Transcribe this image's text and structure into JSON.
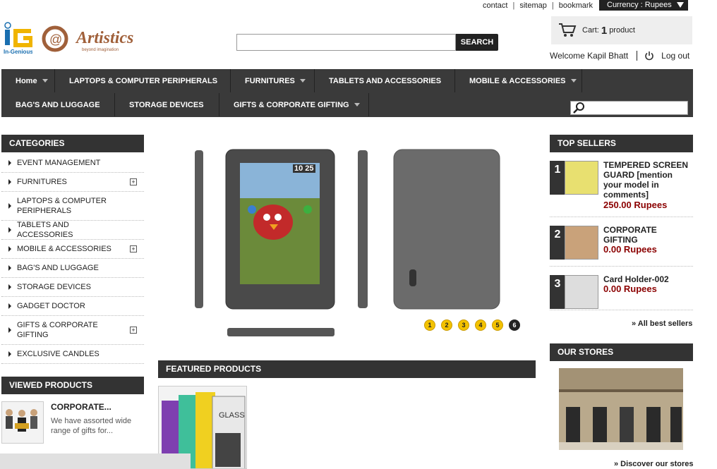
{
  "top_links": [
    "contact",
    "sitemap",
    "bookmark"
  ],
  "currency_label": "Currency : Rupees",
  "logo": {
    "brand1": "In-Genious",
    "brand2": "Artistics",
    "tagline": "beyond imagination"
  },
  "search": {
    "button": "SEARCH",
    "placeholder": ""
  },
  "cart": {
    "label": "Cart:",
    "count": "1",
    "unit": "product"
  },
  "user": {
    "welcome": "Welcome Kapil Bhatt",
    "logout": "Log out"
  },
  "nav": {
    "row1": [
      "Home",
      "LAPTOPS & COMPUTER PERIPHERALS",
      "FURNITURES",
      "TABLETS AND ACCESSORIES",
      "MOBILE & ACCESSORIES"
    ],
    "row2": [
      "BAG'S AND LUGGAGE",
      "STORAGE DEVICES",
      "GIFTS & CORPORATE GIFTING"
    ]
  },
  "categories": {
    "title": "CATEGORIES",
    "items": [
      "EVENT MANAGEMENT",
      "FURNITURES",
      "LAPTOPS & COMPUTER PERIPHERALS",
      "TABLETS AND ACCESSORIES",
      "MOBILE & ACCESSORIES",
      "BAG'S AND LUGGAGE",
      "STORAGE DEVICES",
      "GADGET DOCTOR",
      "GIFTS & CORPORATE GIFTING",
      "EXCLUSIVE CANDLES"
    ]
  },
  "viewed": {
    "title": "VIEWED PRODUCTS",
    "name": "CORPORATE...",
    "desc": "We have assorted wide range of gifts for..."
  },
  "slider": {
    "pages": [
      "1",
      "2",
      "3",
      "4",
      "5",
      "6"
    ],
    "active": "6",
    "clock": "10 25"
  },
  "featured": {
    "title": "FEATURED PRODUCTS",
    "product_text": "GLASS"
  },
  "top_sellers": {
    "title": "TOP SELLERS",
    "items": [
      {
        "rank": "1",
        "name": "TEMPERED SCREEN GUARD [mention your model in comments]",
        "price": "250.00 Rupees"
      },
      {
        "rank": "2",
        "name": "CORPORATE GIFTING",
        "price": "0.00 Rupees"
      },
      {
        "rank": "3",
        "name": "Card Holder-002",
        "price": "0.00 Rupees"
      }
    ],
    "all_link": "» All best sellers"
  },
  "stores": {
    "title": "OUR STORES",
    "link": "» Discover our stores"
  }
}
